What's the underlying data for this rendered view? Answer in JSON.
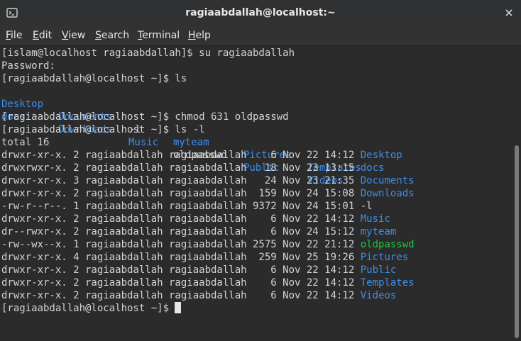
{
  "window": {
    "title": "ragiaabdallah@localhost:~"
  },
  "menu": {
    "items": [
      {
        "label": "File"
      },
      {
        "label": "Edit"
      },
      {
        "label": "View"
      },
      {
        "label": "Search"
      },
      {
        "label": "Terminal"
      },
      {
        "label": "Help"
      }
    ]
  },
  "terminal": {
    "prompt1": "[islam@localhost ragiaabdallah]$ su ragiaabdallah",
    "password_label": "Password:",
    "prompt2": "[ragiaabdallah@localhost ~]$ ls",
    "ls_row1": {
      "a": "Desktop",
      "b": "Documents",
      "c": "-l",
      "d": "myteam",
      "e": "Pictures",
      "f": "Templates"
    },
    "ls_row2": {
      "a": "docs",
      "b": "Downloads",
      "c": "Music",
      "d": "oldpasswd",
      "e": "Public",
      "f": "Videos"
    },
    "prompt3": "[ragiaabdallah@localhost ~]$ chmod 631 oldpasswd",
    "prompt4": "[ragiaabdallah@localhost ~]$ ls -l",
    "total": "total 16",
    "entries": [
      {
        "prefix": "drwxr-xr-x. 2 ragiaabdallah ragiaabdallah    6 Nov 22 14:12 ",
        "name": "Desktop"
      },
      {
        "prefix": "drwxrwxr-x. 2 ragiaabdallah ragiaabdallah   18 Nov 23 13:15 ",
        "name": "docs"
      },
      {
        "prefix": "drwxr-xr-x. 3 ragiaabdallah ragiaabdallah   24 Nov 23 21:35 ",
        "name": "Documents"
      },
      {
        "prefix": "drwxr-xr-x. 2 ragiaabdallah ragiaabdallah  159 Nov 24 15:08 ",
        "name": "Downloads"
      },
      {
        "prefix": "-rw-r--r--. 1 ragiaabdallah ragiaabdallah 9372 Nov 24 15:01 ",
        "name": "-l"
      },
      {
        "prefix": "drwxr-xr-x. 2 ragiaabdallah ragiaabdallah    6 Nov 22 14:12 ",
        "name": "Music"
      },
      {
        "prefix": "dr--rwxr-x. 2 ragiaabdallah ragiaabdallah    6 Nov 24 15:12 ",
        "name": "myteam"
      },
      {
        "prefix": "-rw--wx--x. 1 ragiaabdallah ragiaabdallah 2575 Nov 22 21:12 ",
        "name": "oldpasswd"
      },
      {
        "prefix": "drwxr-xr-x. 4 ragiaabdallah ragiaabdallah  259 Nov 25 19:26 ",
        "name": "Pictures"
      },
      {
        "prefix": "drwxr-xr-x. 2 ragiaabdallah ragiaabdallah    6 Nov 22 14:12 ",
        "name": "Public"
      },
      {
        "prefix": "drwxr-xr-x. 2 ragiaabdallah ragiaabdallah    6 Nov 22 14:12 ",
        "name": "Templates"
      },
      {
        "prefix": "drwxr-xr-x. 2 ragiaabdallah ragiaabdallah    6 Nov 22 14:12 ",
        "name": "Videos"
      }
    ],
    "final_prompt": "[ragiaabdallah@localhost ~]$ "
  },
  "colors": {
    "directory": "#3b8eea",
    "executable": "#23c244",
    "text": "#d3d3d3"
  },
  "icons": {
    "titlebar_left": "terminal-icon",
    "titlebar_right": "close-icon"
  }
}
